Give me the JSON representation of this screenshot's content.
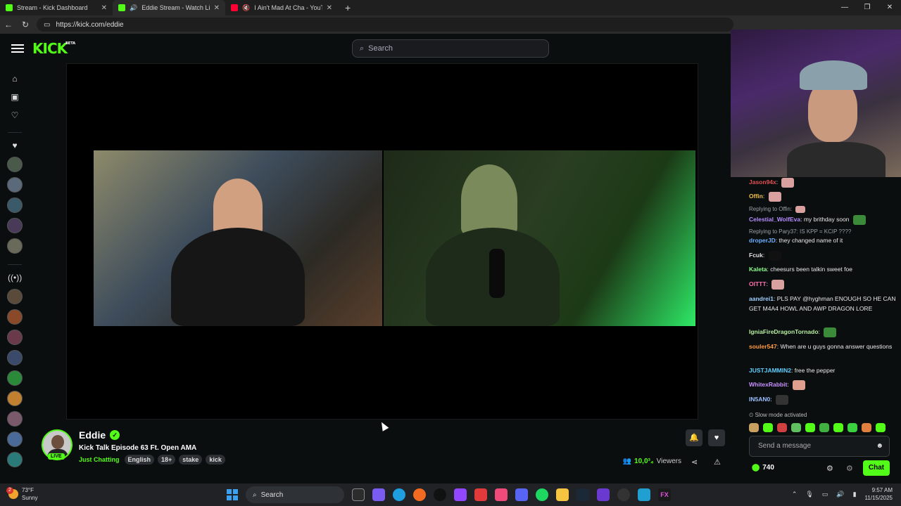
{
  "browser": {
    "tabs": [
      {
        "title": "Stream - Kick Dashboard",
        "color": "#53fc18"
      },
      {
        "title": "Eddie Stream - Watch Live o",
        "color": "#53fc18"
      },
      {
        "title": "I Ain't Mad At Cha - YouTub",
        "color": "#ff0033"
      }
    ],
    "url": "https://kick.com/eddie"
  },
  "header": {
    "logo": "KICK",
    "logo_badge": "BETA",
    "search_placeholder": "Search"
  },
  "stream": {
    "streamer": "Eddie",
    "live_label": "LIVE",
    "title": "Kick Talk Episode 63 Ft. Open AMA",
    "category": "Just Chatting",
    "tags": [
      "English",
      "18+",
      "stake",
      "kick"
    ],
    "viewers": "10,0³₄",
    "viewers_label": "Viewers"
  },
  "chat": {
    "messages": [
      {
        "user": "Jason94x",
        "text": "",
        "color": "#e05050",
        "emote": "#d9a0a0"
      },
      {
        "user": "Offin",
        "text": "",
        "color": "#f0c040",
        "emote": "#d9a0a0"
      },
      {
        "reply": "Replying to Offin:"
      },
      {
        "user": "Celestial_WolfEva",
        "text": "my brithday soon",
        "color": "#b48cff",
        "emote": "#3a8a3a"
      },
      {
        "reply": "Replying to Pary37: IS KPP = KCIP ????"
      },
      {
        "user": "droperJD",
        "text": "they changed name of it",
        "color": "#6ab0ff"
      },
      {
        "user": "Fcuk",
        "text": "",
        "color": "#e0e0e0",
        "emote": "#111111"
      },
      {
        "user": "Kaleta",
        "text": "cheesurs been talkin sweet foe",
        "color": "#8cff8c"
      },
      {
        "user": "OITTT",
        "text": "",
        "color": "#ff70b0",
        "emote": "#d9a0a0"
      },
      {
        "user": "aandrei1",
        "text": "PLS PAY @hyghman ENOUGH SO HE CAN GET M4A4 HOWL AND AWP DRAGON LORE",
        "color": "#a0d0ff"
      },
      {
        "user": "IgniaFireDragonTornado",
        "text": "",
        "color": "#b6f0a0",
        "emote": "#3a8a3a"
      },
      {
        "user": "souler547",
        "text": "When are u guys gonna answer questions",
        "color": "#ff9c40"
      },
      {
        "user": "JUSTJAMMIN2",
        "text": "free the pepper",
        "color": "#5fd0ff"
      },
      {
        "user": "WhitexRabbit",
        "text": "",
        "color": "#c890ff",
        "emote": "#e0a090"
      },
      {
        "user": "IN5AN0",
        "text": "",
        "color": "#9ac0ff",
        "emote": "#333333"
      }
    ],
    "slow_mode": "Slow mode activated",
    "input_placeholder": "Send a message",
    "points": "740",
    "chat_button": "Chat"
  },
  "taskbar": {
    "temp": "73°F",
    "condition": "Sunny",
    "badge": "2",
    "search": "Search",
    "time": "9:57 AM",
    "date": "11/15/2025"
  },
  "colors": {
    "accent": "#53fc18",
    "background": "#0b0e0f"
  }
}
